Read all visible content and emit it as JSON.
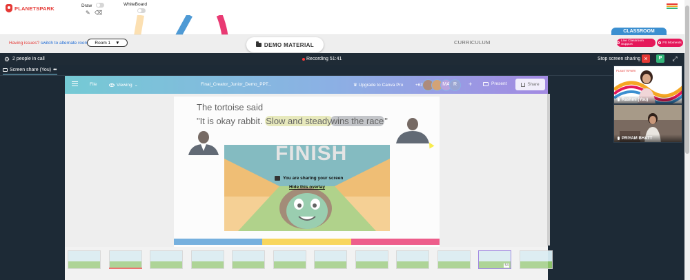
{
  "header": {
    "logo_text": "PLANETSPARK",
    "draw_label": "Draw",
    "whiteboard_label": "WhiteBoard",
    "menu_colors": [
      "#e53935",
      "#f5a623",
      "#33b679"
    ]
  },
  "tabs": {
    "issues_prefix": "Having issues?",
    "issues_link": " switch to alternate room",
    "room_select": "Room 1",
    "demo_material": "DEMO MATERIAL",
    "curriculum": "CURRICULUM",
    "classroom_tab": "CLASSROOM",
    "live_support": "Live Classroom Support",
    "ps_moments": "PS Moments"
  },
  "call": {
    "people": "2 people in call",
    "recording": "Recording 51:41",
    "stop_sharing": "Stop screen sharing",
    "p_badge": "P",
    "screen_share_tab": "Screen share (You)"
  },
  "canva": {
    "file": "File",
    "viewing": "Viewing",
    "doc_title": "Final_Creator_Junior_Demo_PPT...",
    "upgrade": "Upgrade to Canva Pro",
    "collab_count": "+63",
    "avatars": [
      {
        "letter": "",
        "color": "#8a5a44"
      },
      {
        "letter": "",
        "color": "#c07b3b"
      },
      {
        "letter": "MA",
        "color": "#9a7bd0"
      },
      {
        "letter": "R",
        "color": "#6f7fbf"
      }
    ],
    "present": "Present",
    "share": "Share"
  },
  "slide": {
    "line1": "The tortoise said",
    "line2_pre": "\"It is okay rabbit. ",
    "highlight1": "Slow and steady",
    "highlight2": "wins the race",
    "line2_post": "\"",
    "finish_word": "FINISH",
    "stripe_colors": [
      "#3b8fd0",
      "#f5c518",
      "#e5185a"
    ]
  },
  "overlay": {
    "message": "You are sharing your screen",
    "hide_link": "Hide this overlay"
  },
  "thumbnails": [
    {
      "num": ""
    },
    {
      "num": "",
      "has_bar": true
    },
    {
      "num": ""
    },
    {
      "num": ""
    },
    {
      "num": ""
    },
    {
      "num": ""
    },
    {
      "num": ""
    },
    {
      "num": ""
    },
    {
      "num": ""
    },
    {
      "num": ""
    },
    {
      "num": "54",
      "active": true
    },
    {
      "num": ""
    }
  ],
  "participants": [
    {
      "name": "Rashmi (You)"
    },
    {
      "name": "PRIYAM BHATT"
    }
  ]
}
